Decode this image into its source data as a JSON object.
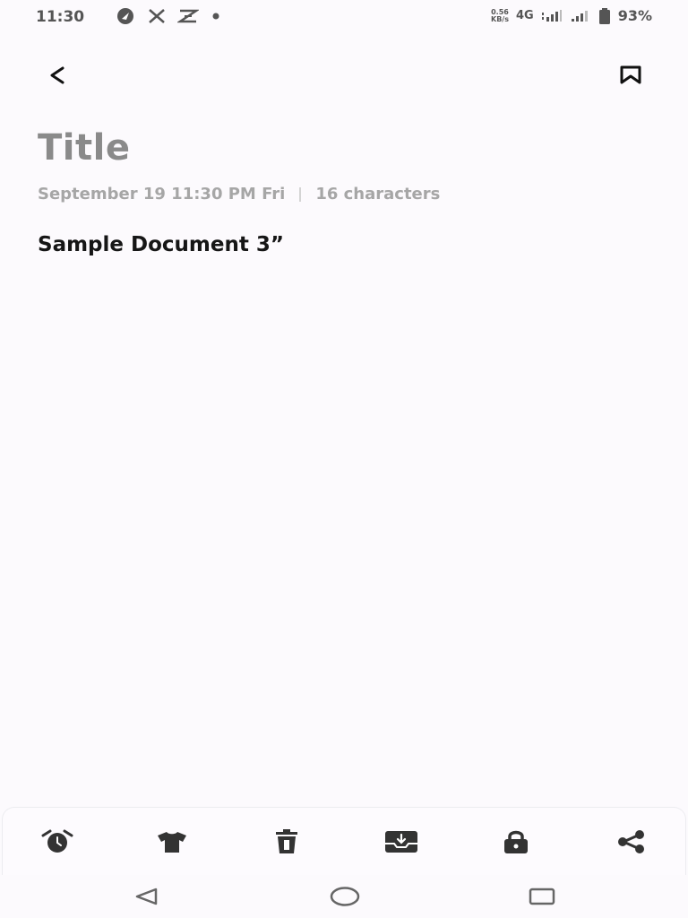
{
  "status_bar": {
    "time": "11:30",
    "net_speed_value": "0.56",
    "net_speed_unit": "KB/s",
    "network": "4G",
    "battery": "93%",
    "left_icons": [
      "navigation-icon",
      "x-icon",
      "capcut-icon",
      "dot-icon"
    ],
    "right_icons": [
      "signal-4g-icon",
      "signal-icon",
      "battery-icon"
    ]
  },
  "top_bar": {
    "back_icon": "chevron-left-icon",
    "bookmark_icon": "bookmark-icon"
  },
  "note": {
    "title": "Title",
    "date": "September 19 11:30 PM Fri",
    "char_count": "16 characters",
    "body": "Sample Document 3”"
  },
  "toolbar": {
    "items": [
      "alarm-icon",
      "shirt-icon",
      "trash-icon",
      "archive-icon",
      "lock-icon",
      "share-icon"
    ]
  },
  "nav_bar": {
    "items": [
      "back-triangle-icon",
      "home-circle-icon",
      "recents-square-icon"
    ]
  },
  "colors": {
    "background": "#fcfafd",
    "title_gray": "#8a8a8a",
    "meta_gray": "#a6a6a6",
    "icon_dark": "#333333"
  }
}
